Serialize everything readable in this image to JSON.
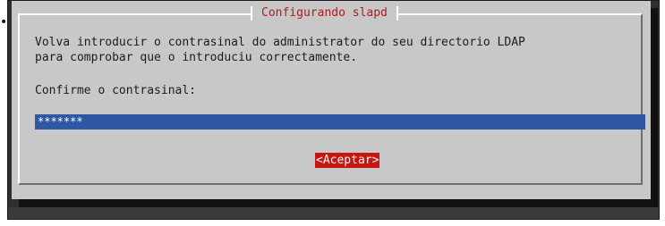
{
  "dialog": {
    "title": "Configurando slapd",
    "message_line1": "Volva introducir o contrasinal do administrator do seu directorio LDAP",
    "message_line2": "para comprobar que o introduciu correctamente.",
    "prompt": "Confirme o contrasinal:",
    "password_value": "*******",
    "ok_label": "<Aceptar>"
  },
  "page": {
    "bullet": "•"
  },
  "colors": {
    "dialog_bg": "#c8c8c8",
    "title_text": "#b11a1a",
    "input_bg": "#2e57a4",
    "ok_button_bg": "#c5160f",
    "backdrop": "#2f2f2f"
  }
}
